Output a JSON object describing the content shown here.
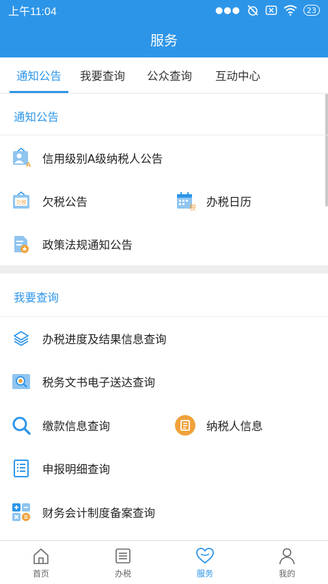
{
  "status": {
    "time": "上午11:04",
    "battery": "23"
  },
  "header": {
    "title": "服务"
  },
  "tabs": [
    {
      "label": "通知公告",
      "active": true
    },
    {
      "label": "我要查询",
      "active": false
    },
    {
      "label": "公众查询",
      "active": false
    },
    {
      "label": "互动中心",
      "active": false
    }
  ],
  "notice": {
    "title": "通知公告",
    "items": [
      {
        "label": "信用级别A级纳税人公告",
        "icon": "credit-a-icon"
      },
      {
        "label": "欠税公告",
        "icon": "tax-arrears-icon",
        "icon_text": "欠税"
      },
      {
        "label": "办税日历",
        "icon": "calendar-icon",
        "icon_text": "税"
      },
      {
        "label": "政策法规通知公告",
        "icon": "policy-document-icon"
      }
    ]
  },
  "query": {
    "title": "我要查询",
    "items": [
      {
        "label": "办税进度及结果信息查询",
        "icon": "layers-icon"
      },
      {
        "label": "税务文书电子送达查询",
        "icon": "document-search-icon"
      },
      {
        "label": "缴款信息查询",
        "icon": "search-icon"
      },
      {
        "label": "纳税人信息",
        "icon": "taxpayer-info-icon"
      },
      {
        "label": "申报明细查询",
        "icon": "list-icon"
      },
      {
        "label": "财务会计制度备案查询",
        "icon": "calculator-icon"
      }
    ]
  },
  "bottom_nav": [
    {
      "label": "首页",
      "icon": "home-icon",
      "active": false
    },
    {
      "label": "办税",
      "icon": "tasks-icon",
      "active": false
    },
    {
      "label": "服务",
      "icon": "heart-icon",
      "active": true
    },
    {
      "label": "我的",
      "icon": "user-icon",
      "active": false
    }
  ],
  "colors": {
    "primary": "#2d95e8",
    "orange": "#f0a23b",
    "light_blue": "#8fc5f0"
  }
}
